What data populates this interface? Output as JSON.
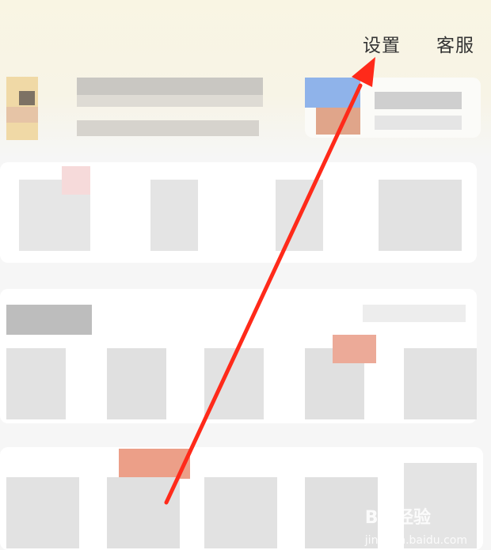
{
  "header": {
    "settings_label": "设置",
    "service_label": "客服"
  },
  "colors": {
    "header_bg": "#f9f5e3",
    "annotation_arrow": "#ff2a1a"
  },
  "icons": {
    "arrow": "red-annotation-arrow",
    "watermark": "baidu-jingyan-logo"
  },
  "watermark": {
    "brand": "Bai",
    "suffix": "经验",
    "url": "jingyan.baidu.com"
  }
}
